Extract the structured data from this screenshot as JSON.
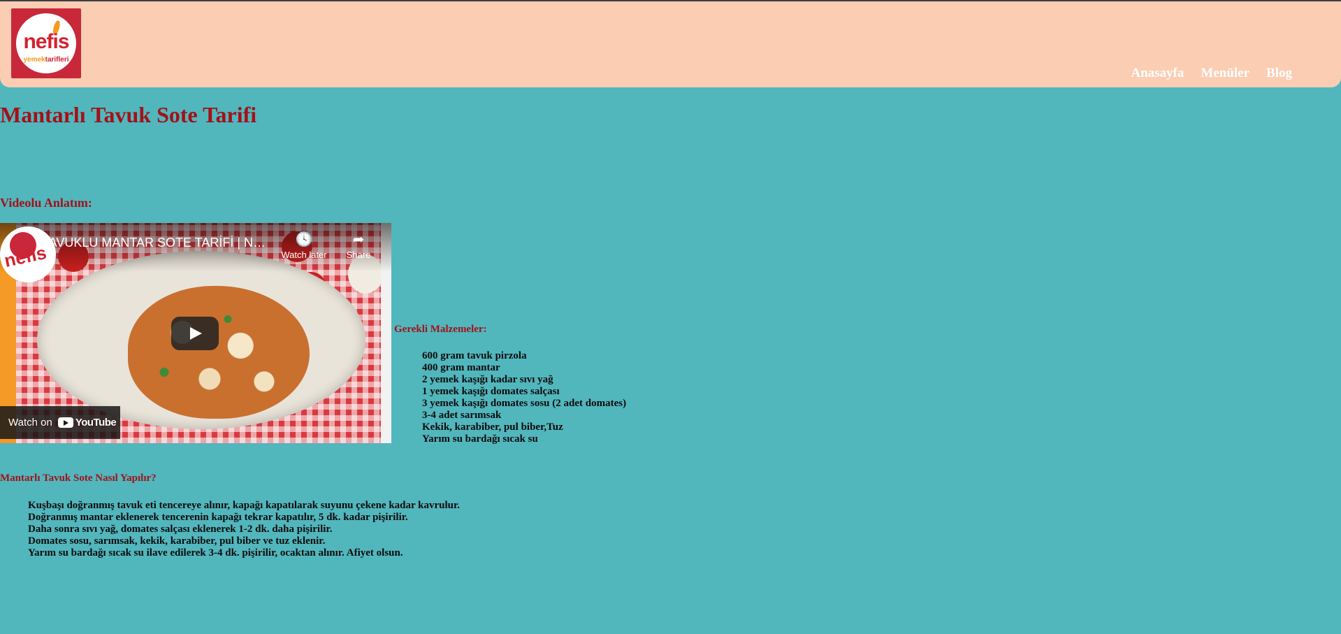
{
  "header": {
    "logo": {
      "main": "nefis",
      "sub_a": "yemek",
      "sub_b": "tarifleri"
    },
    "nav": [
      "Anasayfa",
      "Menüler",
      "Blog"
    ]
  },
  "page": {
    "title": "Mantarlı Tavuk Sote Tarifi",
    "video_section_label": "Videolu Anlatım:",
    "ingredients_label": "Gerekli Malzemeler:",
    "steps_label": "Mantarlı Tavuk Sote Nasıl Yapılır?"
  },
  "video": {
    "title": "TAVUKLU MANTAR SOTE TARİFİ | NASIL YAPILIR?",
    "watch_later": "Watch later",
    "share": "Share",
    "watch_on": "Watch on",
    "youtube": "YouTube",
    "channel_word": "nefis"
  },
  "ingredients": [
    "600 gram tavuk pirzola",
    "400 gram mantar",
    "2 yemek kaşığı kadar sıvı yağ",
    "1 yemek kaşığı domates salçası",
    "3 yemek kaşığı domates sosu (2 adet domates)",
    "3-4 adet sarımsak",
    "Kekik, karabiber, pul biber,Tuz",
    "Yarım su bardağı sıcak su"
  ],
  "steps": [
    "Kuşbaşı doğranmış tavuk eti tencereye alınır, kapağı kapatılarak suyunu çekene kadar kavrulur.",
    "Doğranmış mantar eklenerek tencerenin kapağı tekrar kapatılır, 5 dk. kadar pişirilir.",
    "Daha sonra sıvı yağ, domates salçası eklenerek 1-2 dk. daha pişirilir.",
    "Domates sosu, sarımsak, kekik, karabiber, pul biber ve tuz eklenir.",
    "Yarım su bardağı sıcak su ilave edilerek 3-4 dk. pişirilir, ocaktan alınır. Afiyet olsun."
  ],
  "colors": {
    "background": "#52b6bd",
    "header_bg": "#fbcdb2",
    "heading": "#a11218",
    "logo_red": "#c8283a"
  }
}
